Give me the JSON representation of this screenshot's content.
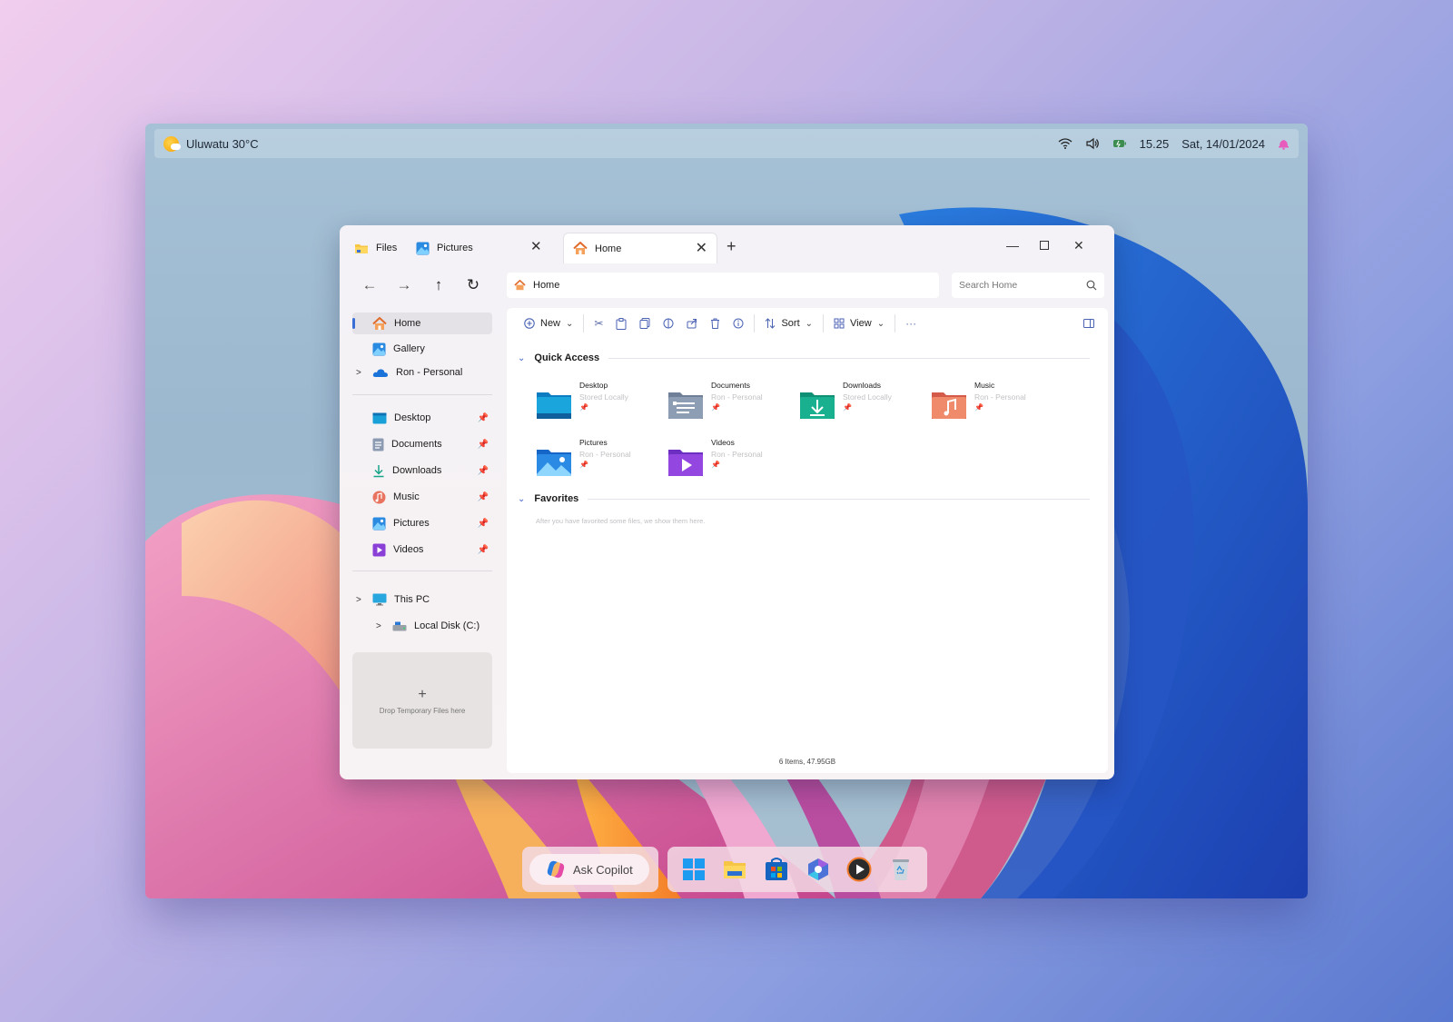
{
  "topbar": {
    "weather": "Uluwatu 30°C",
    "time": "15.25",
    "date": "Sat, 14/01/2024",
    "icons": [
      "wifi-icon",
      "volume-icon",
      "battery-icon",
      "notification-bell-icon"
    ]
  },
  "window": {
    "tabs": [
      {
        "label": "Files",
        "icon": "folder-icon"
      },
      {
        "label": "Pictures",
        "icon": "pictures-icon"
      },
      {
        "label": "Home",
        "icon": "home-icon",
        "active": true
      }
    ],
    "address": "Home",
    "search_placeholder": "Search Home",
    "sidebar": {
      "top": [
        {
          "label": "Home",
          "icon": "home-icon",
          "selected": true
        },
        {
          "label": "Gallery",
          "icon": "gallery-icon"
        },
        {
          "label": "Ron - Personal",
          "icon": "onedrive-icon",
          "expandable": true
        }
      ],
      "pinned": [
        {
          "label": "Desktop",
          "icon": "desktop-icon"
        },
        {
          "label": "Documents",
          "icon": "documents-icon"
        },
        {
          "label": "Downloads",
          "icon": "downloads-icon"
        },
        {
          "label": "Music",
          "icon": "music-icon"
        },
        {
          "label": "Pictures",
          "icon": "pictures-icon"
        },
        {
          "label": "Videos",
          "icon": "videos-icon"
        }
      ],
      "this_pc": "This PC",
      "local_disk": "Local Disk (C:)",
      "drop_zone": "Drop Temporary Files here"
    },
    "toolbar": {
      "new": "New",
      "sort": "Sort",
      "view": "View",
      "more": "···"
    },
    "quick_access": {
      "title": "Quick Access",
      "items": [
        {
          "name": "Desktop",
          "sub": "Stored Locally",
          "icon": "desktop-folder-icon"
        },
        {
          "name": "Documents",
          "sub": "Ron - Personal",
          "icon": "documents-folder-icon"
        },
        {
          "name": "Downloads",
          "sub": "Stored Locally",
          "icon": "downloads-folder-icon"
        },
        {
          "name": "Music",
          "sub": "Ron - Personal",
          "icon": "music-folder-icon"
        },
        {
          "name": "Pictures",
          "sub": "Ron - Personal",
          "icon": "pictures-folder-icon"
        },
        {
          "name": "Videos",
          "sub": "Ron - Personal",
          "icon": "videos-folder-icon"
        }
      ]
    },
    "favorites": {
      "title": "Favorites",
      "empty_note": "After you have favorited some files, we show them here."
    },
    "status": "6 Items, 47.95GB"
  },
  "dock": {
    "copilot_label": "Ask Copilot",
    "apps": [
      "start-icon",
      "file-explorer-icon",
      "store-icon",
      "copilot-app-icon",
      "media-player-icon",
      "recycle-bin-icon"
    ]
  }
}
